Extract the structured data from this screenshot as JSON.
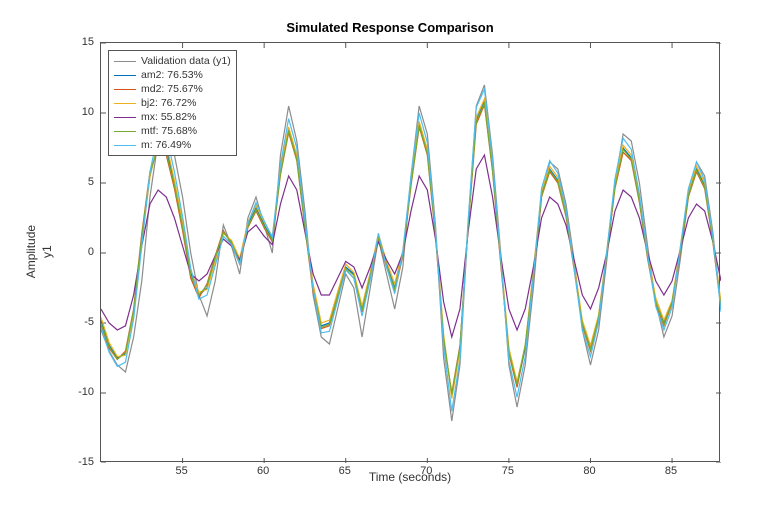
{
  "chart_data": {
    "type": "line",
    "title": "Simulated Response Comparison",
    "xlabel": "Time (seconds)",
    "ylabel_top": "Amplitude",
    "ylabel_bottom": "y1",
    "xlim": [
      50,
      88
    ],
    "ylim": [
      -15,
      15
    ],
    "xticks": [
      55,
      60,
      65,
      70,
      75,
      80,
      85
    ],
    "yticks": [
      -15,
      -10,
      -5,
      0,
      5,
      10,
      15
    ],
    "x": [
      50,
      50.5,
      51,
      51.5,
      52,
      52.5,
      53,
      53.5,
      54,
      54.5,
      55,
      55.5,
      56,
      56.5,
      57,
      57.5,
      58,
      58.5,
      59,
      59.5,
      60,
      60.5,
      61,
      61.5,
      62,
      62.5,
      63,
      63.5,
      64,
      64.5,
      65,
      65.5,
      66,
      66.5,
      67,
      67.5,
      68,
      68.5,
      69,
      69.5,
      70,
      70.5,
      71,
      71.5,
      72,
      72.5,
      73,
      73.5,
      74,
      74.5,
      75,
      75.5,
      76,
      76.5,
      77,
      77.5,
      78,
      78.5,
      79,
      79.5,
      80,
      80.5,
      81,
      81.5,
      82,
      82.5,
      83,
      83.5,
      84,
      84.5,
      85,
      85.5,
      86,
      86.5,
      87,
      87.5,
      88
    ],
    "series": [
      {
        "name": "Validation data (y1)",
        "color": "#8c8c8c",
        "values": [
          -5.5,
          -7.0,
          -8.0,
          -8.5,
          -6.0,
          -2.0,
          4.0,
          8.0,
          9.0,
          7.0,
          4.0,
          0.0,
          -3.0,
          -4.5,
          -2.0,
          2.0,
          0.5,
          -1.5,
          2.5,
          4.0,
          2.0,
          0.0,
          7.0,
          10.5,
          8.0,
          3.0,
          -3.0,
          -6.0,
          -6.5,
          -4.0,
          -1.5,
          -2.5,
          -6.0,
          -2.5,
          1.0,
          -1.5,
          -4.0,
          -1.0,
          5.5,
          10.5,
          8.5,
          2.0,
          -7.5,
          -12.0,
          -8.0,
          2.0,
          10.5,
          12.0,
          7.0,
          0.0,
          -8.0,
          -11.0,
          -8.0,
          -2.5,
          4.0,
          6.5,
          6.0,
          3.5,
          -0.5,
          -5.5,
          -8.0,
          -5.5,
          -0.5,
          5.0,
          8.5,
          8.0,
          5.0,
          0.5,
          -3.5,
          -6.0,
          -4.5,
          -0.5,
          4.0,
          6.5,
          5.5,
          1.5,
          -4.0
        ]
      },
      {
        "name": "am2: 76.53%",
        "color": "#0072bd",
        "values": [
          -4.8,
          -6.6,
          -7.5,
          -7.2,
          -4.2,
          1.0,
          5.5,
          7.8,
          7.5,
          5.0,
          2.0,
          -1.5,
          -3.0,
          -2.5,
          -0.5,
          1.5,
          0.8,
          -0.5,
          2.0,
          3.2,
          2.0,
          1.0,
          5.8,
          8.8,
          6.8,
          2.0,
          -2.5,
          -5.2,
          -5.0,
          -3.0,
          -1.0,
          -1.5,
          -4.0,
          -1.5,
          1.2,
          -0.8,
          -2.5,
          0.0,
          5.0,
          9.2,
          7.2,
          1.5,
          -6.0,
          -10.2,
          -6.8,
          2.0,
          9.5,
          10.8,
          6.0,
          -0.5,
          -7.0,
          -9.5,
          -6.8,
          -1.5,
          4.2,
          6.0,
          5.2,
          2.8,
          -1.0,
          -5.0,
          -6.8,
          -4.5,
          0.0,
          4.8,
          7.5,
          6.8,
          3.8,
          -0.2,
          -3.5,
          -5.0,
          -3.5,
          0.2,
          4.2,
          6.0,
          4.8,
          1.0,
          -3.8
        ]
      },
      {
        "name": "md2: 75.67%",
        "color": "#d95319",
        "values": [
          -5.2,
          -6.8,
          -7.6,
          -7.0,
          -4.0,
          1.4,
          5.8,
          7.5,
          7.0,
          4.6,
          1.6,
          -1.8,
          -3.2,
          -2.2,
          -0.2,
          1.6,
          0.6,
          -0.8,
          1.8,
          3.0,
          1.8,
          0.8,
          5.6,
          8.6,
          6.6,
          1.8,
          -2.8,
          -5.4,
          -5.2,
          -3.2,
          -1.2,
          -1.8,
          -4.2,
          -1.8,
          1.0,
          -1.0,
          -2.8,
          -0.2,
          4.8,
          9.0,
          7.0,
          1.2,
          -6.2,
          -10.0,
          -6.6,
          1.8,
          9.2,
          10.6,
          5.8,
          -0.8,
          -7.2,
          -9.6,
          -6.6,
          -1.8,
          4.0,
          5.8,
          5.0,
          2.6,
          -1.2,
          -5.2,
          -7.0,
          -4.6,
          -0.2,
          4.6,
          7.2,
          6.6,
          3.6,
          -0.4,
          -3.6,
          -5.2,
          -3.6,
          0.0,
          4.0,
          5.8,
          4.6,
          0.8,
          -4.0
        ]
      },
      {
        "name": "bj2: 76.72%",
        "color": "#edb120",
        "values": [
          -4.6,
          -6.4,
          -7.4,
          -7.3,
          -4.4,
          0.8,
          5.4,
          8.0,
          7.8,
          5.2,
          2.2,
          -1.2,
          -2.8,
          -2.6,
          -0.6,
          1.4,
          0.9,
          -0.4,
          2.2,
          3.4,
          2.2,
          1.2,
          6.0,
          9.0,
          7.0,
          2.2,
          -2.2,
          -5.0,
          -4.8,
          -2.8,
          -0.8,
          -1.4,
          -3.8,
          -1.4,
          1.4,
          -0.6,
          -2.2,
          0.2,
          5.2,
          9.4,
          7.4,
          1.7,
          -5.8,
          -10.4,
          -7.0,
          2.2,
          9.7,
          11.0,
          6.2,
          -0.2,
          -6.8,
          -9.2,
          -6.6,
          -1.2,
          4.4,
          6.2,
          5.4,
          3.0,
          -0.8,
          -4.8,
          -6.6,
          -4.4,
          0.2,
          5.0,
          7.7,
          7.0,
          4.0,
          0.0,
          -3.2,
          -4.8,
          -3.4,
          0.4,
          4.4,
          6.2,
          5.0,
          1.2,
          -3.6
        ]
      },
      {
        "name": "mx: 55.82%",
        "color": "#7e2f8e",
        "values": [
          -4.0,
          -5.0,
          -5.5,
          -5.2,
          -3.0,
          0.5,
          3.5,
          4.5,
          4.0,
          2.5,
          0.5,
          -1.5,
          -2.0,
          -1.5,
          -0.2,
          1.0,
          0.5,
          -0.5,
          1.5,
          2.0,
          1.2,
          0.6,
          3.5,
          5.5,
          4.5,
          1.5,
          -1.5,
          -3.0,
          -3.0,
          -1.8,
          -0.6,
          -1.0,
          -2.5,
          -1.0,
          0.8,
          -0.5,
          -1.5,
          0.0,
          3.0,
          5.5,
          4.5,
          1.0,
          -3.5,
          -6.0,
          -4.0,
          1.5,
          6.0,
          7.0,
          4.0,
          -0.2,
          -4.0,
          -5.5,
          -4.0,
          -1.0,
          2.5,
          4.0,
          3.5,
          2.0,
          -0.5,
          -3.0,
          -4.0,
          -2.5,
          0.0,
          3.0,
          4.5,
          4.0,
          2.5,
          0.0,
          -2.0,
          -3.0,
          -2.0,
          0.2,
          2.5,
          3.5,
          3.0,
          0.8,
          -2.0
        ]
      },
      {
        "name": "mtf: 75.68%",
        "color": "#77ac30",
        "values": [
          -5.0,
          -6.7,
          -7.6,
          -7.1,
          -4.1,
          1.2,
          5.7,
          7.6,
          7.2,
          4.8,
          1.8,
          -1.6,
          -3.0,
          -2.3,
          -0.3,
          1.5,
          0.7,
          -0.7,
          1.9,
          3.1,
          1.9,
          0.9,
          5.7,
          8.7,
          6.7,
          1.9,
          -2.6,
          -5.3,
          -5.1,
          -3.1,
          -1.1,
          -1.6,
          -4.1,
          -1.6,
          1.1,
          -0.9,
          -2.6,
          -0.1,
          4.9,
          9.1,
          7.1,
          1.4,
          -6.1,
          -10.1,
          -6.7,
          1.9,
          9.4,
          10.7,
          5.9,
          -0.6,
          -7.1,
          -9.4,
          -6.6,
          -1.6,
          4.1,
          5.9,
          5.1,
          2.7,
          -1.1,
          -5.1,
          -6.9,
          -4.6,
          -0.1,
          4.7,
          7.4,
          6.7,
          3.7,
          -0.3,
          -3.5,
          -5.1,
          -3.5,
          0.1,
          4.1,
          5.9,
          4.7,
          0.9,
          -3.9
        ]
      },
      {
        "name": "m: 76.49%",
        "color": "#4dbeee",
        "values": [
          -5.3,
          -7.1,
          -8.1,
          -7.8,
          -4.7,
          0.5,
          5.8,
          8.6,
          8.4,
          5.8,
          2.6,
          -1.1,
          -3.3,
          -3.0,
          -0.9,
          1.2,
          0.6,
          -0.8,
          2.1,
          3.6,
          2.3,
          1.1,
          6.3,
          9.6,
          7.5,
          2.4,
          -2.6,
          -5.7,
          -5.6,
          -3.4,
          -1.2,
          -1.8,
          -4.5,
          -1.9,
          1.4,
          -1.0,
          -2.9,
          0.1,
          5.5,
          10.0,
          7.9,
          1.7,
          -6.7,
          -11.3,
          -7.6,
          2.3,
          10.4,
          11.7,
          6.6,
          -0.4,
          -7.7,
          -10.3,
          -7.4,
          -1.7,
          4.6,
          6.6,
          5.7,
          3.1,
          -1.1,
          -5.5,
          -7.4,
          -4.9,
          0.1,
          5.3,
          8.2,
          7.4,
          4.2,
          -0.1,
          -3.8,
          -5.5,
          -3.9,
          0.3,
          4.6,
          6.5,
          5.2,
          1.2,
          -4.2
        ]
      }
    ],
    "legend": [
      {
        "label": "Validation data (y1)",
        "color": "#8c8c8c"
      },
      {
        "label": "am2: 76.53%",
        "color": "#0072bd"
      },
      {
        "label": "md2: 75.67%",
        "color": "#d95319"
      },
      {
        "label": "bj2: 76.72%",
        "color": "#edb120"
      },
      {
        "label": "mx: 55.82%",
        "color": "#7e2f8e"
      },
      {
        "label": "mtf: 75.68%",
        "color": "#77ac30"
      },
      {
        "label": "m: 76.49%",
        "color": "#4dbeee"
      }
    ]
  }
}
